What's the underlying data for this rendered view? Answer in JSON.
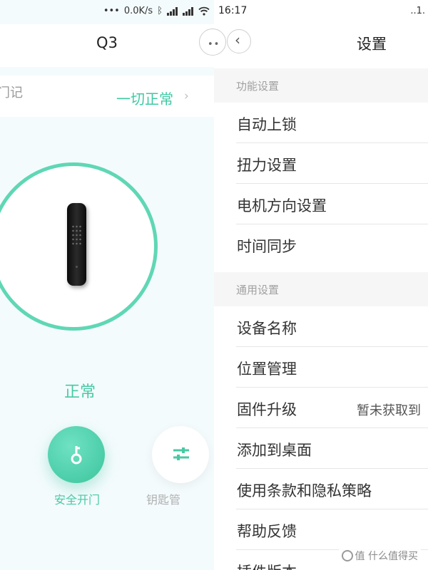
{
  "left_pane": {
    "status_bar": {
      "network_speed": "0.0K/s"
    },
    "title": "Q3",
    "more_button": "••",
    "record_label": "门记",
    "status_summary": "一切正常",
    "chevron": "›",
    "lock_state": "正常",
    "unlock_label": "安全开门",
    "key_manage_label": "钥匙管"
  },
  "right_pane": {
    "status_bar": {
      "time": "16:17",
      "right_edge": "..1."
    },
    "back_glyph": "‹",
    "title": "设置",
    "sections": [
      {
        "header": "功能设置",
        "rows": [
          {
            "label": "自动上锁"
          },
          {
            "label": "扭力设置"
          },
          {
            "label": "电机方向设置"
          },
          {
            "label": "时间同步"
          }
        ]
      },
      {
        "header": "通用设置",
        "rows": [
          {
            "label": "设备名称"
          },
          {
            "label": "位置管理"
          },
          {
            "label": "固件升级",
            "value": "暂未获取到"
          },
          {
            "label": "添加到桌面"
          },
          {
            "label": "使用条款和隐私策略"
          },
          {
            "label": "帮助反馈"
          },
          {
            "label": "插件版本"
          }
        ]
      }
    ]
  },
  "watermark": "值 什么值得买",
  "colors": {
    "accent": "#48c9a4",
    "ring": "#5fd7b5"
  }
}
